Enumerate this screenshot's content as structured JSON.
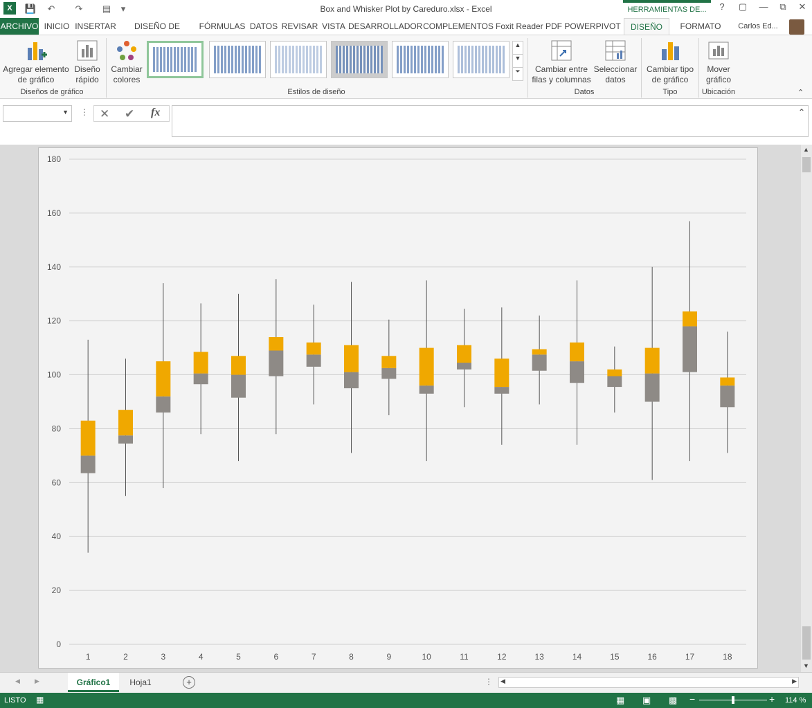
{
  "window": {
    "title": "Box and Whisker Plot by Careduro.xlsx - Excel",
    "context_tab": "HERRAMIENTAS DE...",
    "help": "?",
    "user": "Carlos Ed..."
  },
  "tabs": [
    "ARCHIVO",
    "INICIO",
    "INSERTAR",
    "DISEÑO DE PÁGINA",
    "FÓRMULAS",
    "DATOS",
    "REVISAR",
    "VISTA",
    "DESARROLLADOR",
    "COMPLEMENTOS",
    "Foxit Reader PDF",
    "POWERPIVOT",
    "DISEÑO",
    "FORMATO"
  ],
  "ribbon": {
    "add_element_1": "Agregar elemento",
    "add_element_2": "de gráfico",
    "quick_layout_1": "Diseño",
    "quick_layout_2": "rápido",
    "group_layouts": "Diseños de gráfico",
    "change_colors_1": "Cambiar",
    "change_colors_2": "colores",
    "group_styles": "Estilos de diseño",
    "switch_1": "Cambiar entre",
    "switch_2": "filas y columnas",
    "select_data_1": "Seleccionar",
    "select_data_2": "datos",
    "group_data": "Datos",
    "change_type_1": "Cambiar tipo",
    "change_type_2": "de gráfico",
    "group_type": "Tipo",
    "move_1": "Mover",
    "move_2": "gráfico",
    "group_location": "Ubicación"
  },
  "formula_bar": {
    "fx": "fx",
    "name_box": "",
    "formula": ""
  },
  "sheets": [
    "Gráfico1",
    "Hoja1"
  ],
  "status": {
    "ready": "LISTO",
    "zoom": "114 %"
  },
  "colors": {
    "accent": "#217346",
    "box_upper": "#f0a800",
    "box_lower": "#8e8a86",
    "whisker": "#555555"
  },
  "chart_data": {
    "type": "boxplot",
    "categories": [
      "1",
      "2",
      "3",
      "4",
      "5",
      "6",
      "7",
      "8",
      "9",
      "10",
      "11",
      "12",
      "13",
      "14",
      "15",
      "16",
      "17",
      "18"
    ],
    "min": [
      34,
      55,
      58,
      78,
      68,
      78,
      89,
      71,
      85,
      68,
      88,
      74,
      89,
      74,
      86,
      61,
      68,
      71
    ],
    "q1": [
      63.5,
      74.5,
      86,
      96.5,
      91.5,
      99.5,
      103,
      95,
      98.5,
      93,
      102,
      93,
      101.5,
      97,
      95.5,
      90,
      101,
      88
    ],
    "median": [
      70,
      77.5,
      92,
      100.5,
      100,
      109,
      107.5,
      101,
      102.5,
      96,
      104.5,
      95.5,
      107.5,
      105,
      99.5,
      100.5,
      118,
      96
    ],
    "q3": [
      83,
      87,
      105,
      108.5,
      107,
      114,
      112,
      111,
      107,
      110,
      111,
      106,
      109.5,
      112,
      102,
      110,
      123.5,
      99
    ],
    "max": [
      113,
      106,
      134,
      126.5,
      130,
      135.5,
      126,
      134.5,
      120.5,
      135,
      124.5,
      125,
      122,
      135,
      110.5,
      140,
      157,
      116
    ],
    "ylim": [
      0,
      180
    ],
    "yticks": [
      0,
      20,
      40,
      60,
      80,
      100,
      120,
      140,
      160,
      180
    ],
    "grid": true
  }
}
